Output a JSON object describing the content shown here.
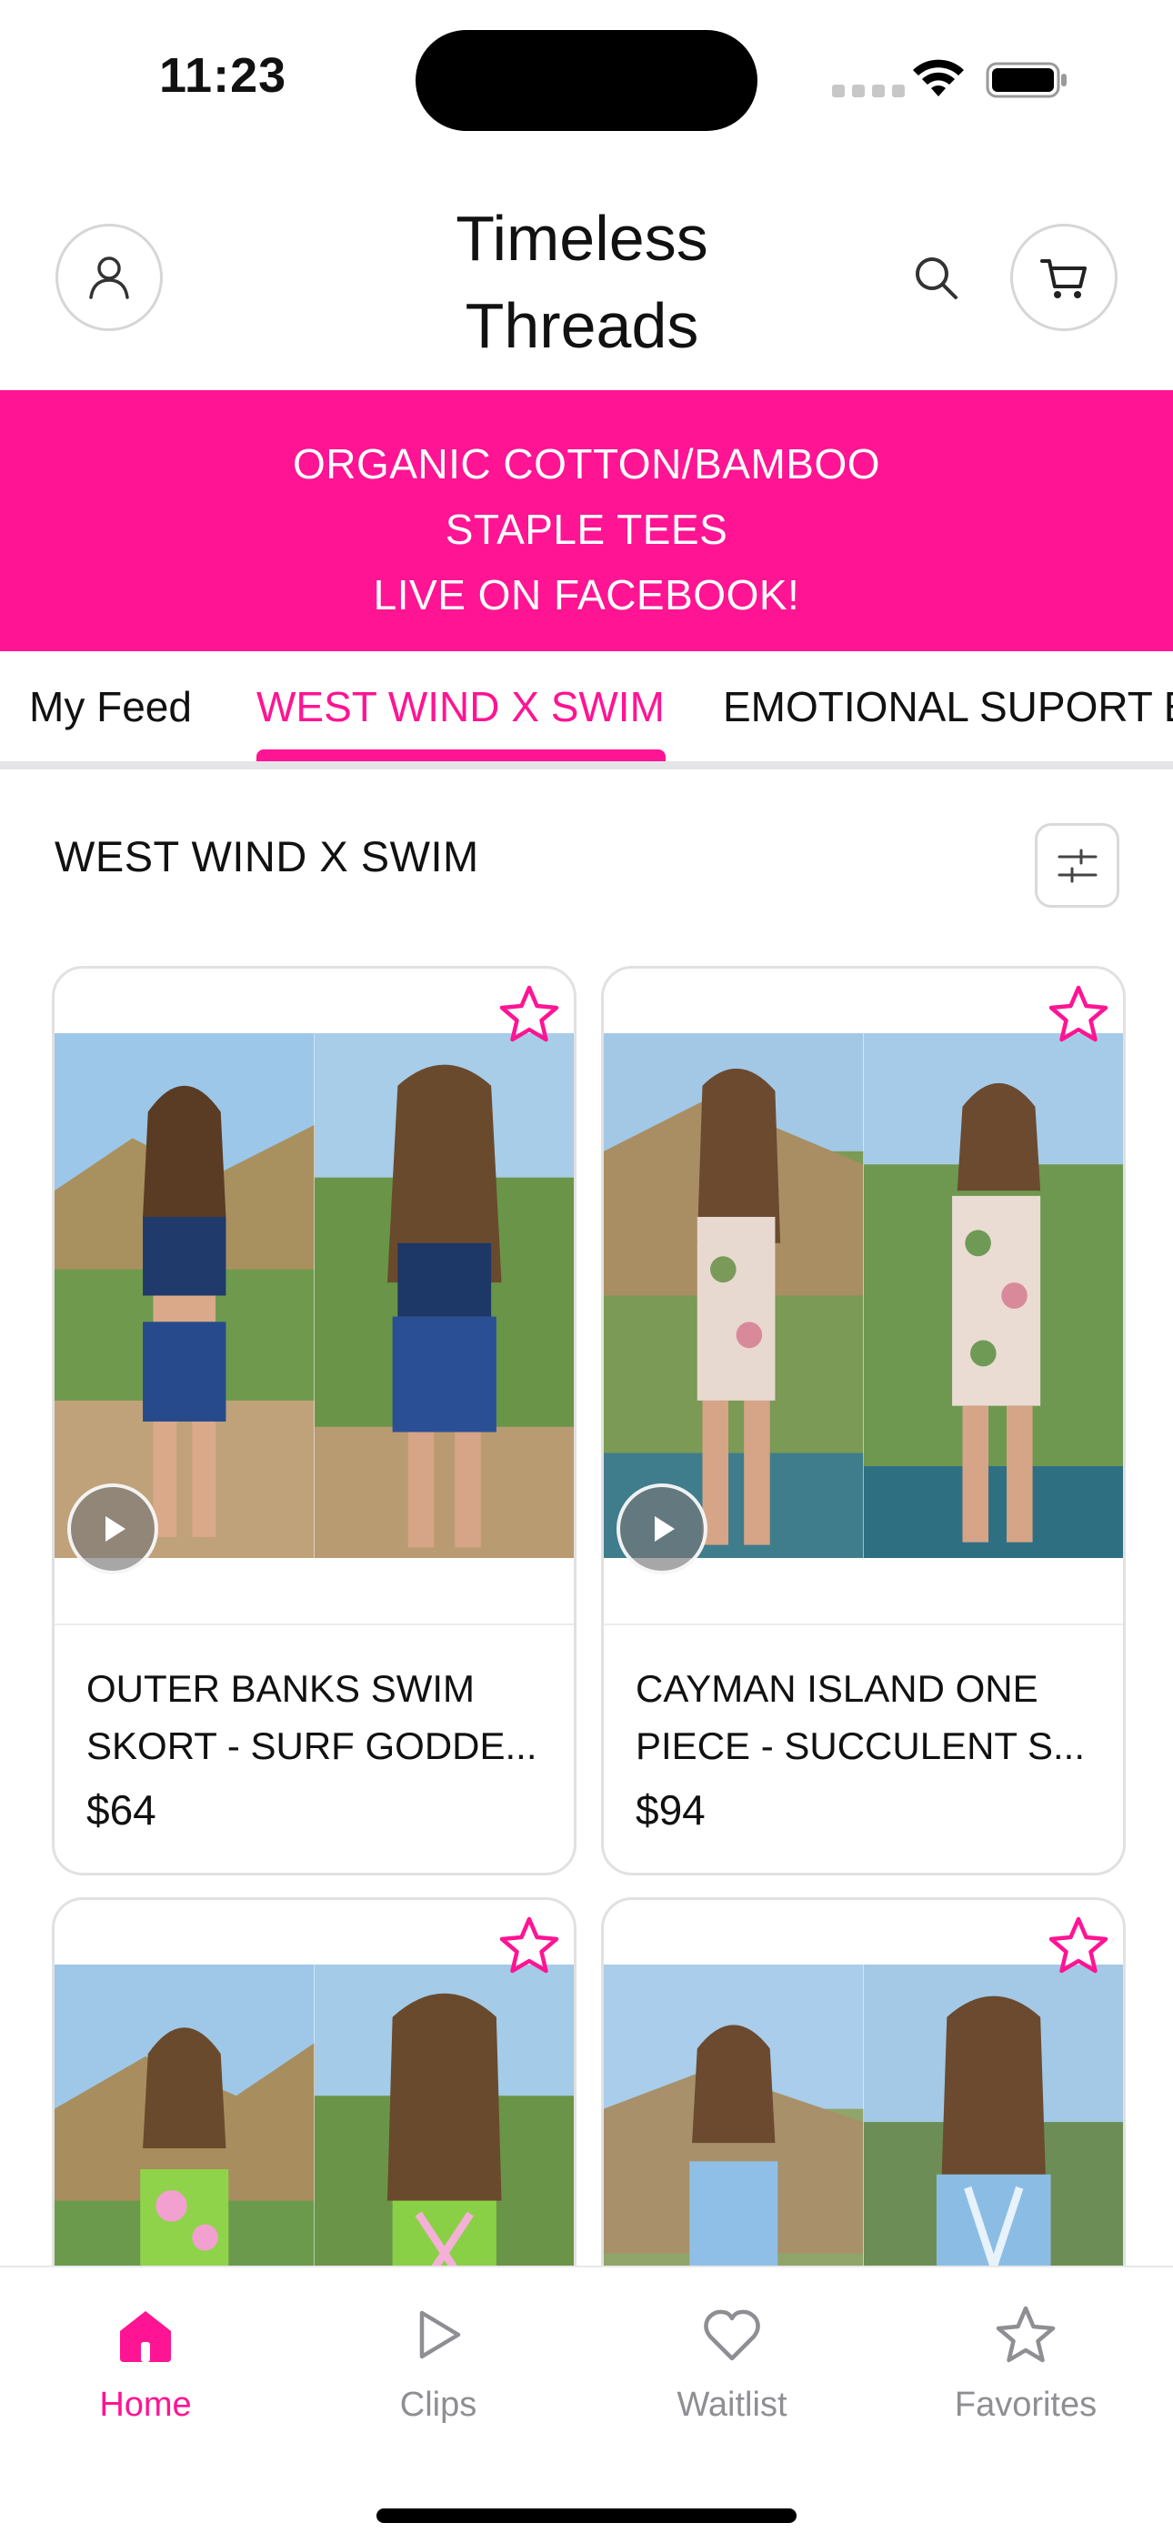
{
  "status_bar": {
    "time": "11:23"
  },
  "header": {
    "store_title_line1": "Timeless",
    "store_title_line2": "Threads"
  },
  "banner": {
    "line1": "ORGANIC COTTON/BAMBOO",
    "line2": "STAPLE TEES",
    "line3": "LIVE ON FACEBOOK!"
  },
  "tabs": [
    {
      "label": "My Feed",
      "active": false
    },
    {
      "label": "WEST WIND X SWIM",
      "active": true
    },
    {
      "label": "EMOTIONAL SUPORT E",
      "active": false
    }
  ],
  "section": {
    "title": "WEST WIND X SWIM"
  },
  "products": [
    {
      "name_line1": "OUTER BANKS SWIM",
      "name_line2": "SKORT - SURF GODDE...",
      "price": "$64",
      "has_video": true,
      "favorited": false
    },
    {
      "name_line1": "CAYMAN ISLAND ONE",
      "name_line2": "PIECE - SUCCULENT S...",
      "price": "$94",
      "has_video": true,
      "favorited": false
    },
    {
      "has_video": false,
      "favorited": false
    },
    {
      "has_video": false,
      "favorited": false
    }
  ],
  "bottom_nav": {
    "items": [
      {
        "label": "Home",
        "icon": "home-icon",
        "active": true
      },
      {
        "label": "Clips",
        "icon": "play-icon",
        "active": false
      },
      {
        "label": "Waitlist",
        "icon": "heart-icon",
        "active": false
      },
      {
        "label": "Favorites",
        "icon": "star-icon",
        "active": false
      }
    ]
  },
  "colors": {
    "accent": "#ff1493",
    "banner_background": "#ff1493",
    "inactive_nav": "#8e8e93"
  }
}
